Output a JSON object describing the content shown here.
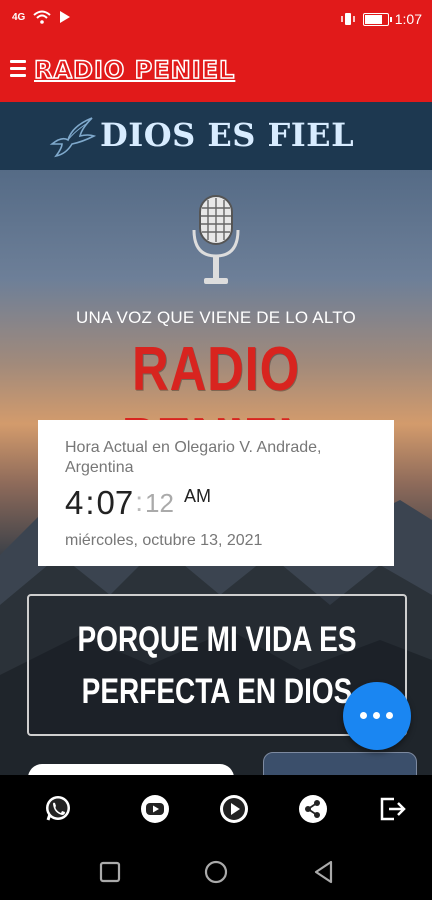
{
  "status_bar": {
    "time": "1:07",
    "signal": "4G"
  },
  "app_bar": {
    "title": "RADIO PENIEL"
  },
  "banner": {
    "title": "DIOS ES FIEL"
  },
  "hero": {
    "tagline": "UNA VOZ QUE VIENE DE LO ALTO",
    "brand": "RADIO PENIEL"
  },
  "clock": {
    "place": "Hora Actual en Olegario V. Andrade, Argentina",
    "hour": "4",
    "minute": "07",
    "second": "12",
    "ampm": "AM",
    "date": "miércoles, octubre 13, 2021"
  },
  "verse": {
    "line1": "PORQUE MI VIDA ES",
    "line2": "PERFECTA EN DIOS"
  },
  "bottom_nav": [
    "whatsapp-icon",
    "youtube-icon",
    "play-icon",
    "share-icon",
    "logout-icon"
  ],
  "colors": {
    "brand_red": "#e11a1a",
    "banner_blue": "#1d3850",
    "fab_blue": "#1a86f2"
  }
}
